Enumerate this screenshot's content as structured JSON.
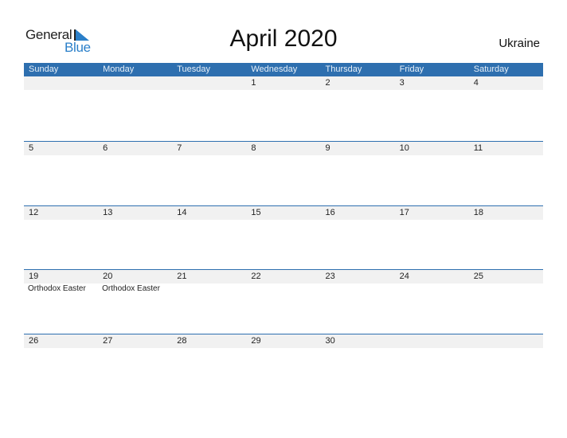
{
  "logo": {
    "word1": "General",
    "word2": "Blue"
  },
  "title": "April 2020",
  "country": "Ukraine",
  "colors": {
    "header_bg": "#2e6faf",
    "accent": "#2a7fc9",
    "date_band": "#f1f1f1"
  },
  "weekdays": [
    "Sunday",
    "Monday",
    "Tuesday",
    "Wednesday",
    "Thursday",
    "Friday",
    "Saturday"
  ],
  "weeks": [
    {
      "days": [
        "",
        "",
        "",
        "1",
        "2",
        "3",
        "4"
      ],
      "events": [
        "",
        "",
        "",
        "",
        "",
        "",
        ""
      ]
    },
    {
      "days": [
        "5",
        "6",
        "7",
        "8",
        "9",
        "10",
        "11"
      ],
      "events": [
        "",
        "",
        "",
        "",
        "",
        "",
        ""
      ]
    },
    {
      "days": [
        "12",
        "13",
        "14",
        "15",
        "16",
        "17",
        "18"
      ],
      "events": [
        "",
        "",
        "",
        "",
        "",
        "",
        ""
      ]
    },
    {
      "days": [
        "19",
        "20",
        "21",
        "22",
        "23",
        "24",
        "25"
      ],
      "events": [
        "Orthodox Easter",
        "Orthodox Easter",
        "",
        "",
        "",
        "",
        ""
      ]
    },
    {
      "days": [
        "26",
        "27",
        "28",
        "29",
        "30",
        "",
        ""
      ],
      "events": [
        "",
        "",
        "",
        "",
        "",
        "",
        ""
      ]
    }
  ]
}
